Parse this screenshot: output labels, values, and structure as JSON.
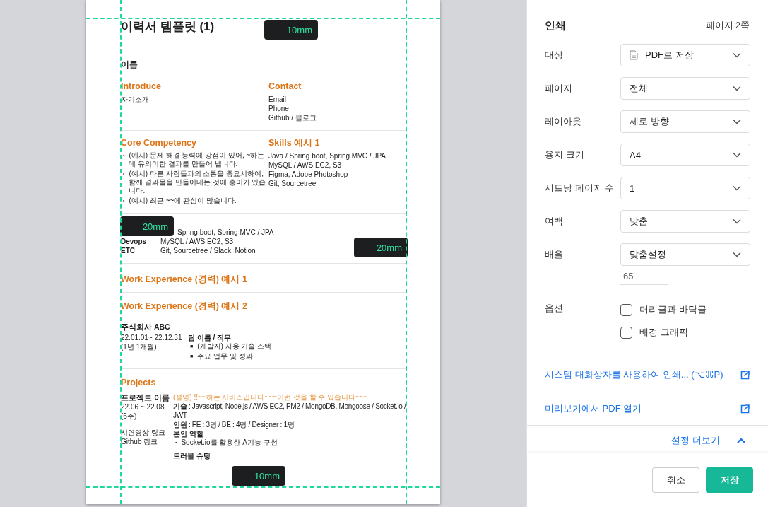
{
  "preview": {
    "title": "이력서 템플릿 (1)",
    "name": "이름",
    "sections": [
      {
        "kind": "two_column",
        "columns": [
          {
            "heading": "Introduce",
            "lines": [
              "자기소개"
            ]
          },
          {
            "heading": "Contact",
            "lines": [
              "Email",
              "Phone",
              "Github / 블로그"
            ]
          }
        ]
      },
      {
        "kind": "two_column",
        "columns": [
          {
            "heading": "Core Competency",
            "marker": "•",
            "bullets": [
              "(예시) 문제 해결 능력에 강점이 있어, ~하는 데 유의미한 결과를 만들어 냅니다.",
              "(예시) 다른 사람들과의 소통을 중요시하여, 함께 결과물을 만들어내는 것에 흥미가 있습니다.",
              "(예시) 최근 ~~에 관심이 많습니다."
            ]
          },
          {
            "heading": "Skills 예시 1",
            "lines": [
              "Java / Spring boot, Spring MVC / JPA",
              "MySQL / AWS EC2, S3",
              "Figma, Adobe Photoshop",
              "Git, Sourcetree"
            ]
          }
        ]
      },
      {
        "kind": "table",
        "rows": [
          {
            "value": "Spring boot, Spring MVC / JPA"
          },
          {
            "label": "Devops",
            "value": "MySQL / AWS EC2, S3"
          },
          {
            "label": "ETC",
            "value": "Git, Sourcetree / Slack, Notion"
          }
        ]
      },
      {
        "kind": "heading",
        "heading": "Work Experience (경력) 예시 1"
      },
      {
        "kind": "experience",
        "heading": "Work Experience (경력) 예시 2",
        "company": "주식회사 ABC",
        "period": [
          "22.01.01~ 22.12.31",
          "(1년 1개월)"
        ],
        "role": "팀 이름 / 직무",
        "marker": "■",
        "bullets": [
          "(개발자) 사용 기술 스택",
          "주요 업무 및 성과"
        ]
      },
      {
        "kind": "project",
        "heading": "Projects",
        "name": "프로젝트 이름",
        "period": [
          "22.06 ~ 22.08",
          "(6주)"
        ],
        "links": [
          "시연영상 링크",
          "Github 링크"
        ],
        "description": "(설명) !!~~하는 서비스입니다~~~이런 것을 할 수 있습니다~~~",
        "details": [
          "**기술** : Javascript, Node.js / AWS EC2, PM2 / MongoDB, Mongoose / Socket.io / JWT",
          "**인원** : FE : 3명 / BE : 4명 / Designer : 1명"
        ],
        "role_title": "본인 역할",
        "marker": "•",
        "role_bullets": [
          "Socket.io를 활용한 A기능 구현"
        ],
        "subheading": "트러블 슈팅"
      }
    ],
    "margin_labels": {
      "top": "10mm",
      "left": "20mm",
      "right": "20mm",
      "bottom": "10mm"
    }
  },
  "print_panel": {
    "title": "인쇄",
    "page_count": "페이지 2쪽",
    "settings": [
      {
        "kind": "destination",
        "label": "대상",
        "value": "PDF로 저장"
      },
      {
        "kind": "select",
        "label": "페이지",
        "value": "전체"
      },
      {
        "kind": "select",
        "label": "레이아웃",
        "value": "세로 방향"
      },
      {
        "kind": "select",
        "label": "용지 크기",
        "value": "A4"
      },
      {
        "kind": "select",
        "label": "시트당 페이지 수",
        "value": "1"
      },
      {
        "kind": "select",
        "label": "여백",
        "value": "맞춤"
      },
      {
        "kind": "scale",
        "label": "배율",
        "value": "맞춤설정",
        "scale_value": "65"
      }
    ],
    "options": {
      "label": "옵션",
      "checkboxes": [
        {
          "label": "머리글과 바닥글",
          "checked": false
        },
        {
          "label": "배경 그래픽",
          "checked": false
        }
      ]
    },
    "links": [
      "시스템 대화상자를 사용하여 인쇄... (⌥⌘P)",
      "미리보기에서 PDF 열기"
    ],
    "more_settings": {
      "label": "설정 더보기",
      "expanded": true
    },
    "buttons": [
      {
        "label": "취소",
        "kind": "secondary"
      },
      {
        "label": "저장",
        "kind": "primary"
      }
    ]
  }
}
